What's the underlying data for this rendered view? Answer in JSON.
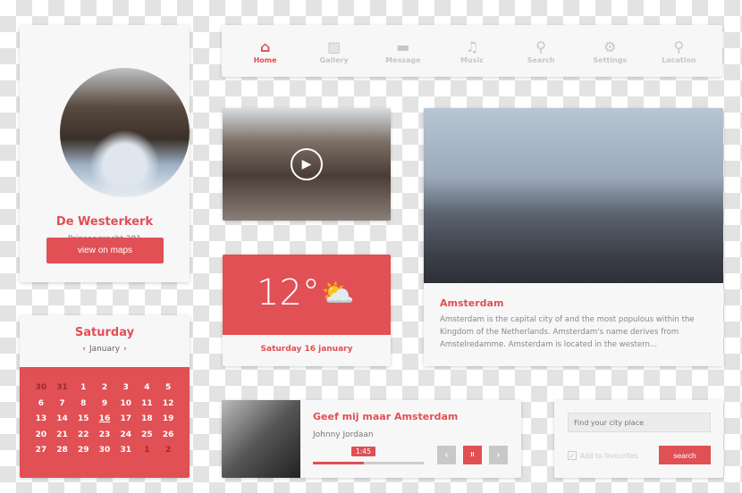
{
  "colors": {
    "accent": "#e05055"
  },
  "profile": {
    "title": "De Westerkerk",
    "subtitle": "Prinsengracht 281",
    "button": "view on maps"
  },
  "calendar": {
    "day": "Saturday",
    "month": "January",
    "prev_icon": "chevron-left-icon",
    "next_icon": "chevron-right-icon",
    "days": [
      "30",
      "31",
      "1",
      "2",
      "3",
      "4",
      "5",
      "6",
      "7",
      "8",
      "9",
      "10",
      "11",
      "12",
      "13",
      "14",
      "15",
      "16",
      "17",
      "18",
      "19",
      "20",
      "21",
      "22",
      "23",
      "24",
      "25",
      "26",
      "27",
      "28",
      "29",
      "30",
      "31",
      "1",
      "2"
    ],
    "today": "16"
  },
  "nav": {
    "items": [
      {
        "label": "Home",
        "icon": "home-icon",
        "active": true
      },
      {
        "label": "Gallery",
        "icon": "gallery-icon"
      },
      {
        "label": "Message",
        "icon": "message-icon"
      },
      {
        "label": "Music",
        "icon": "music-icon"
      },
      {
        "label": "Search",
        "icon": "search-icon"
      },
      {
        "label": "Settings",
        "icon": "gear-icon"
      },
      {
        "label": "Location",
        "icon": "location-pin-icon"
      }
    ]
  },
  "weather": {
    "temp": "12°",
    "icon": "sun-cloud-icon",
    "date": "Saturday 16 january"
  },
  "article": {
    "title": "Amsterdam",
    "text": "Amsterdam is the capital city of and the most populous within the Kingdom of the Netherlands. Amsterdam's name derives from Amstelredamme. Amsterdam is located in the western..."
  },
  "player": {
    "title": "Geef mij maar Amsterdam",
    "artist": "Johnny Jordaan",
    "time": "1:45",
    "progress": 0.46,
    "prev": "‹",
    "pause": "II",
    "next": "›"
  },
  "search": {
    "placeholder": "Find your city place",
    "checkbox_label": "Add to favourites",
    "checked": true,
    "button": "search"
  }
}
